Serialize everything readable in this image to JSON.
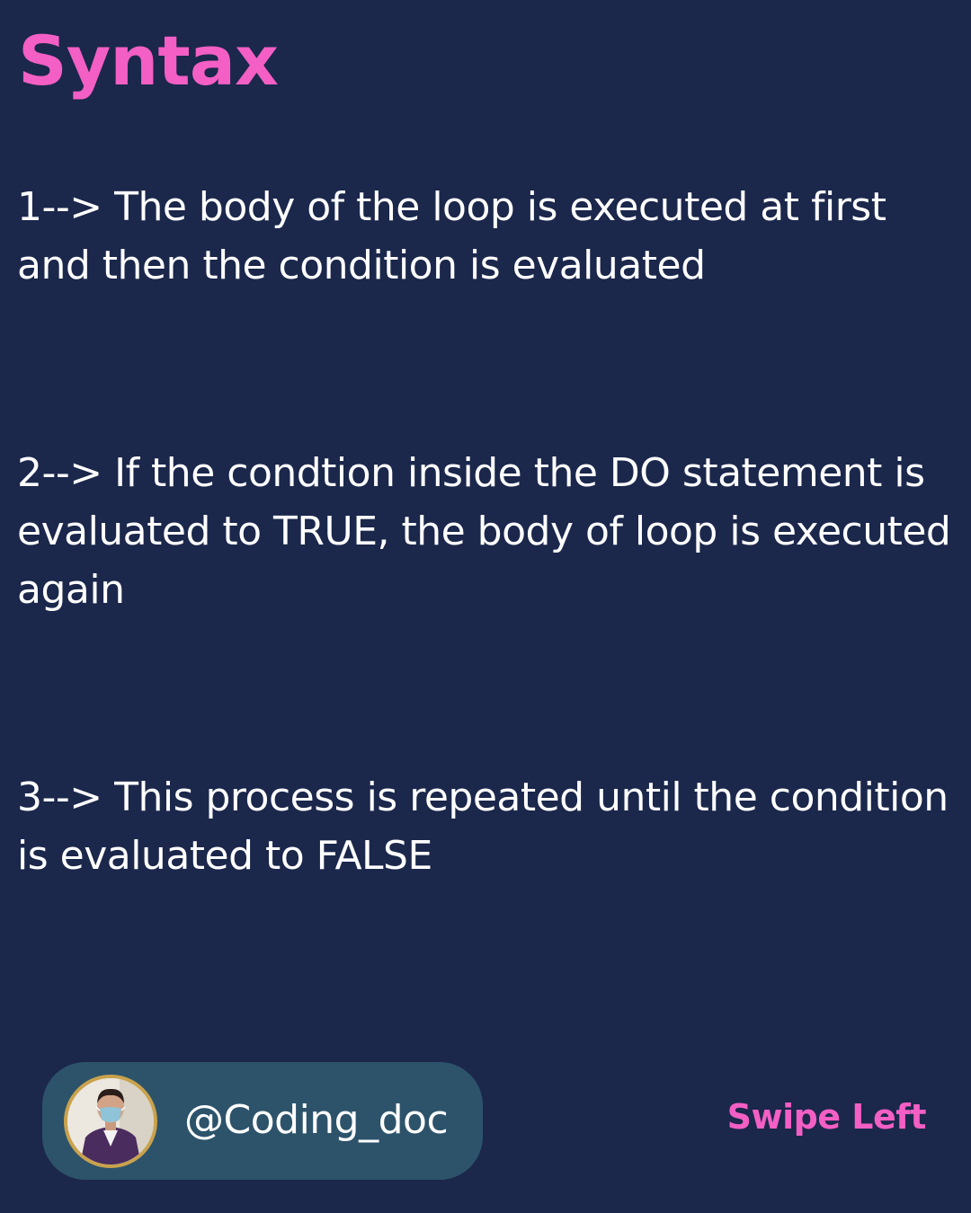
{
  "title": "Syntax",
  "points": [
    "1--> The body of the loop is executed at first and then the condition is evaluated",
    "2--> If the condtion inside the DO statement is evaluated to TRUE, the body of loop is executed again",
    "3--> This process is repeated until the condition is evaluated to FALSE"
  ],
  "profile": {
    "handle": "@Coding_doc",
    "avatar_icon": "profile-photo"
  },
  "swipe_label": "Swipe Left",
  "colors": {
    "background": "#1b274b",
    "accent_pink": "#f35fc4",
    "profile_pill": "#2d536b",
    "avatar_ring": "#c9a24c"
  }
}
